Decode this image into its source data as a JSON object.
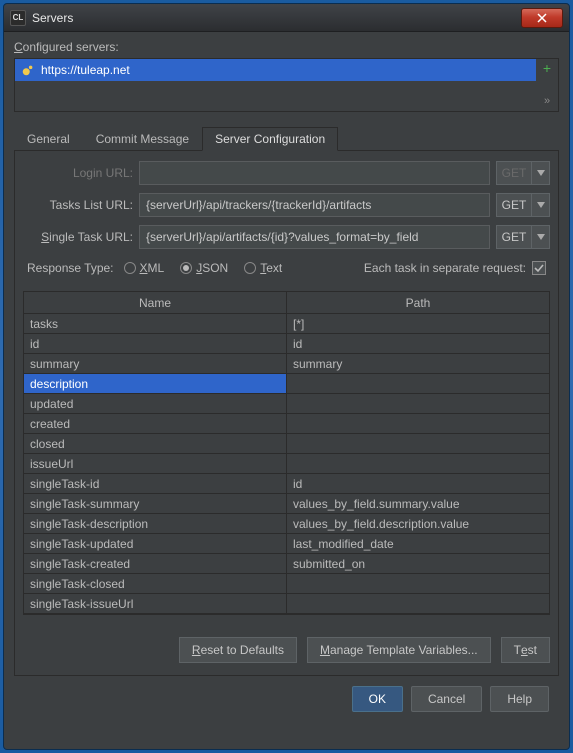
{
  "window": {
    "title": "Servers"
  },
  "configured_label": "Configured servers:",
  "server_list": {
    "item0": "https://tuleap.net"
  },
  "tabs": {
    "general": "General",
    "commit": "Commit Message",
    "server_cfg": "Server Configuration"
  },
  "labels": {
    "login_url": "Login URL:",
    "tasks_list_url": "Tasks List URL:",
    "single_task_url": "Single Task URL:",
    "response_type": "Response Type:",
    "each_task": "Each task in separate request:"
  },
  "fields": {
    "login_url": "",
    "tasks_list_url": "{serverUrl}/api/trackers/{trackerId}/artifacts",
    "single_task_url": "{serverUrl}/api/artifacts/{id}?values_format=by_field"
  },
  "get_btn": "GET",
  "radios": {
    "xml": "XML",
    "json": "JSON",
    "text": "Text"
  },
  "table": {
    "header_name": "Name",
    "header_path": "Path",
    "rows": [
      {
        "name": "tasks",
        "path": "[*]"
      },
      {
        "name": "id",
        "path": "id"
      },
      {
        "name": "summary",
        "path": "summary"
      },
      {
        "name": "description",
        "path": ""
      },
      {
        "name": "updated",
        "path": ""
      },
      {
        "name": "created",
        "path": ""
      },
      {
        "name": "closed",
        "path": ""
      },
      {
        "name": "issueUrl",
        "path": ""
      },
      {
        "name": "singleTask-id",
        "path": "id"
      },
      {
        "name": "singleTask-summary",
        "path": "values_by_field.summary.value"
      },
      {
        "name": "singleTask-description",
        "path": "values_by_field.description.value"
      },
      {
        "name": "singleTask-updated",
        "path": "last_modified_date"
      },
      {
        "name": "singleTask-created",
        "path": "submitted_on"
      },
      {
        "name": "singleTask-closed",
        "path": ""
      },
      {
        "name": "singleTask-issueUrl",
        "path": ""
      }
    ],
    "selected_index": 3
  },
  "buttons": {
    "reset": "Reset to Defaults",
    "manage": "Manage Template Variables...",
    "test": "Test",
    "ok": "OK",
    "cancel": "Cancel",
    "help": "Help"
  }
}
